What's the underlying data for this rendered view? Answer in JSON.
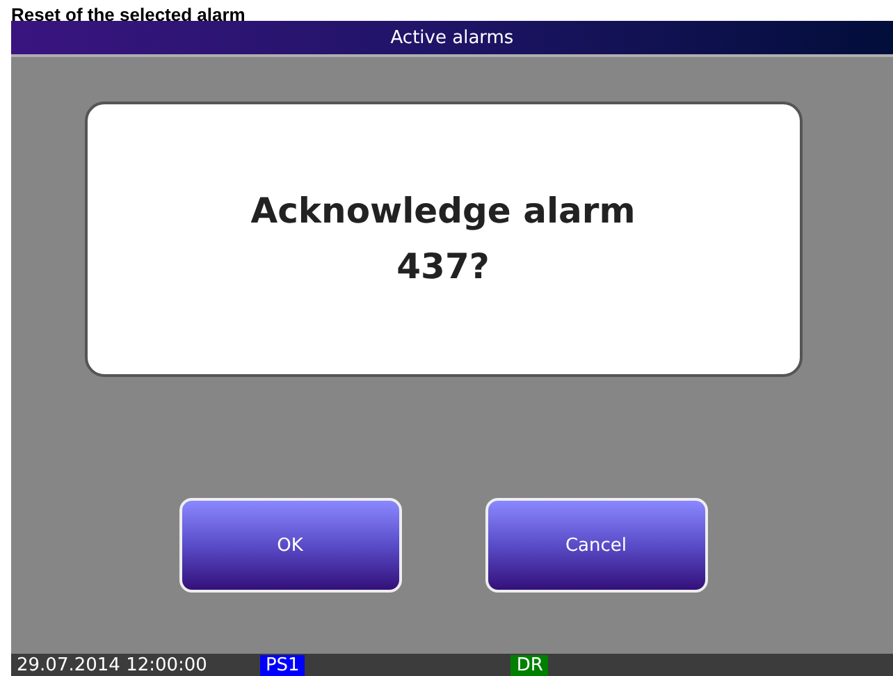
{
  "heading": "Reset of the selected alarm",
  "window": {
    "title": "Active alarms"
  },
  "dialog": {
    "message": "Acknowledge alarm\n437?"
  },
  "buttons": [
    "OK",
    "Cancel"
  ],
  "status_bar": {
    "datetime": "29.07.2014 12:00:00",
    "badges": [
      {
        "label": "PS1",
        "color": "#0000ff"
      },
      {
        "label": "DR",
        "color": "#008000"
      }
    ]
  }
}
